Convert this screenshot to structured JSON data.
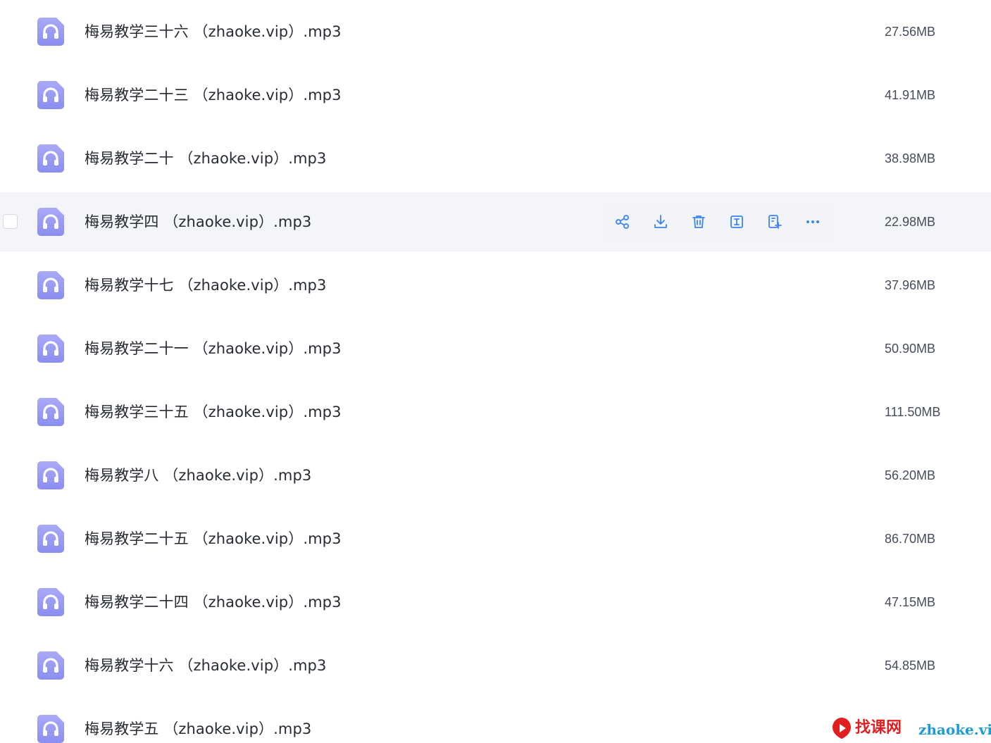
{
  "files": [
    {
      "name": "梅易教学三十六 （zhaoke.vip）.mp3",
      "size": "27.56MB",
      "icon": "headphones-icon"
    },
    {
      "name": "梅易教学二十三 （zhaoke.vip）.mp3",
      "size": "41.91MB",
      "icon": "headphones-icon"
    },
    {
      "name": "梅易教学二十 （zhaoke.vip）.mp3",
      "size": "38.98MB",
      "icon": "headphones-icon"
    },
    {
      "name": "梅易教学四 （zhaoke.vip）.mp3",
      "size": "22.98MB",
      "icon": "headphones-icon",
      "hovered": true
    },
    {
      "name": "梅易教学十七 （zhaoke.vip）.mp3",
      "size": "37.96MB",
      "icon": "headphones-icon"
    },
    {
      "name": "梅易教学二十一 （zhaoke.vip）.mp3",
      "size": "50.90MB",
      "icon": "headphones-icon"
    },
    {
      "name": "梅易教学三十五 （zhaoke.vip）.mp3",
      "size": "111.50MB",
      "icon": "headphones-icon"
    },
    {
      "name": "梅易教学八 （zhaoke.vip）.mp3",
      "size": "56.20MB",
      "icon": "headphones-icon"
    },
    {
      "name": "梅易教学二十五 （zhaoke.vip）.mp3",
      "size": "86.70MB",
      "icon": "headphones-icon"
    },
    {
      "name": "梅易教学二十四 （zhaoke.vip）.mp3",
      "size": "47.15MB",
      "icon": "headphones-icon"
    },
    {
      "name": "梅易教学十六 （zhaoke.vip）.mp3",
      "size": "54.85MB",
      "icon": "headphones-icon"
    },
    {
      "name": "梅易教学五 （zhaoke.vip）.mp3",
      "size": "",
      "icon": "headphones-icon"
    }
  ],
  "row_actions": [
    {
      "name": "share-icon"
    },
    {
      "name": "download-icon"
    },
    {
      "name": "delete-icon"
    },
    {
      "name": "rename-icon"
    },
    {
      "name": "copy-to-icon"
    },
    {
      "name": "more-icon"
    }
  ],
  "watermark": {
    "cn_text": "找课网",
    "en_text": "zhaoke.vip"
  },
  "colors": {
    "icon_gradient_top": "#a5a6f6",
    "icon_gradient_bottom": "#8c8ef0",
    "action_blue": "#3b82f6",
    "hover_row": "#f4f5f9",
    "text": "#272b33",
    "size_text": "#454d5a",
    "watermark_red": "#e02020",
    "watermark_blue": "#1b9bd8"
  }
}
